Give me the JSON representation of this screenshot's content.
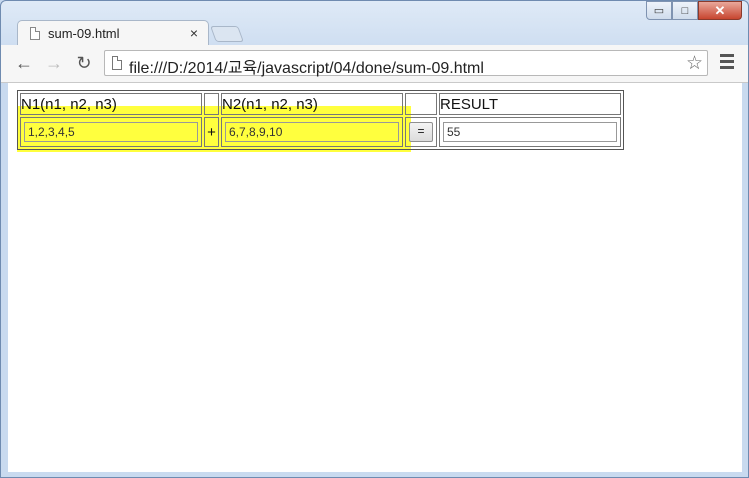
{
  "browser": {
    "tab_title": "sum-09.html",
    "tab_close": "×",
    "url": "file:///D:/2014/교육/javascript/04/done/sum-09.html",
    "back": "←",
    "forward": "→",
    "reload": "↻",
    "star": "☆",
    "window_min": "▭",
    "window_max": "□",
    "window_close": "✕"
  },
  "page": {
    "headers": {
      "n1": "N1(n1, n2, n3)",
      "op_blank": "",
      "n2": "N2(n1, n2, n3)",
      "eq_blank": "",
      "result": "RESULT"
    },
    "inputs": {
      "n1_value": "1,2,3,4,5",
      "operator": "+",
      "n2_value": "6,7,8,9,10",
      "equals_label": "=",
      "result_value": "55"
    }
  },
  "colors": {
    "highlight": "#ffff3e"
  }
}
